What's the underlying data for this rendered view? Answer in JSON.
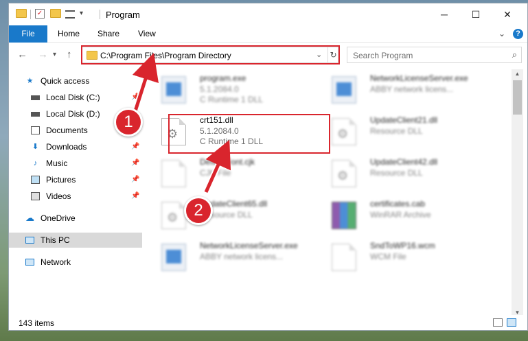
{
  "window": {
    "title": "Program",
    "controls": {
      "minimize": "─",
      "maximize": "☐",
      "close": "✕"
    }
  },
  "ribbon": {
    "tabs": [
      "File",
      "Home",
      "Share",
      "View"
    ],
    "expand": "⌄",
    "help": "?"
  },
  "address": {
    "path": "C:\\Program Files\\Program Directory",
    "search_placeholder": "Search Program"
  },
  "nav": {
    "items": [
      {
        "label": "Quick access",
        "icon": "star-icon"
      },
      {
        "label": "Local Disk (C:)",
        "icon": "drive-icon"
      },
      {
        "label": "Local Disk (D:)",
        "icon": "drive-icon"
      },
      {
        "label": "Documents",
        "icon": "documents-icon"
      },
      {
        "label": "Downloads",
        "icon": "download-icon"
      },
      {
        "label": "Music",
        "icon": "music-icon"
      },
      {
        "label": "Pictures",
        "icon": "pictures-icon"
      },
      {
        "label": "Videos",
        "icon": "videos-icon"
      },
      {
        "label": "OneDrive",
        "icon": "cloud-icon"
      },
      {
        "label": "This PC",
        "icon": "pc-icon"
      },
      {
        "label": "Network",
        "icon": "network-icon"
      }
    ]
  },
  "files": [
    {
      "name": "program.exe",
      "line2": "5.1.2084.0",
      "line3": "C Runtime 1 DLL",
      "icon": "exe-icon"
    },
    {
      "name": "NetworkLicenseServer.exe",
      "line2": "ABBY network licens...",
      "line3": "",
      "icon": "exe-icon"
    },
    {
      "name": "crt151.dll",
      "line2": "5.1.2084.0",
      "line3": "C Runtime 1 DLL",
      "icon": "dll-icon"
    },
    {
      "name": "UpdateClient21.dll",
      "line2": "Resource DLL",
      "line3": "",
      "icon": "dll-icon"
    },
    {
      "name": "DefaultFont.cjk",
      "line2": "CJK File",
      "line3": "",
      "icon": "file-icon"
    },
    {
      "name": "UpdateClient42.dll",
      "line2": "Resource DLL",
      "line3": "",
      "icon": "dll-icon"
    },
    {
      "name": "UpdateClient65.dll",
      "line2": "Resource DLL",
      "line3": "",
      "icon": "dll-icon"
    },
    {
      "name": "certificates.cab",
      "line2": "WinRAR Archive",
      "line3": "",
      "icon": "archive-icon"
    },
    {
      "name": "NetworkLicenseServer.exe",
      "line2": "ABBY network licens...",
      "line3": "",
      "icon": "exe-icon"
    },
    {
      "name": "SndToWP16.wcm",
      "line2": "WCM File",
      "line3": "",
      "icon": "file-icon"
    }
  ],
  "status": {
    "item_count": "143 items"
  },
  "callouts": [
    "1",
    "2"
  ],
  "colors": {
    "accent": "#1979ca",
    "highlight": "#d9252d",
    "selected": "#d9d9d9"
  }
}
